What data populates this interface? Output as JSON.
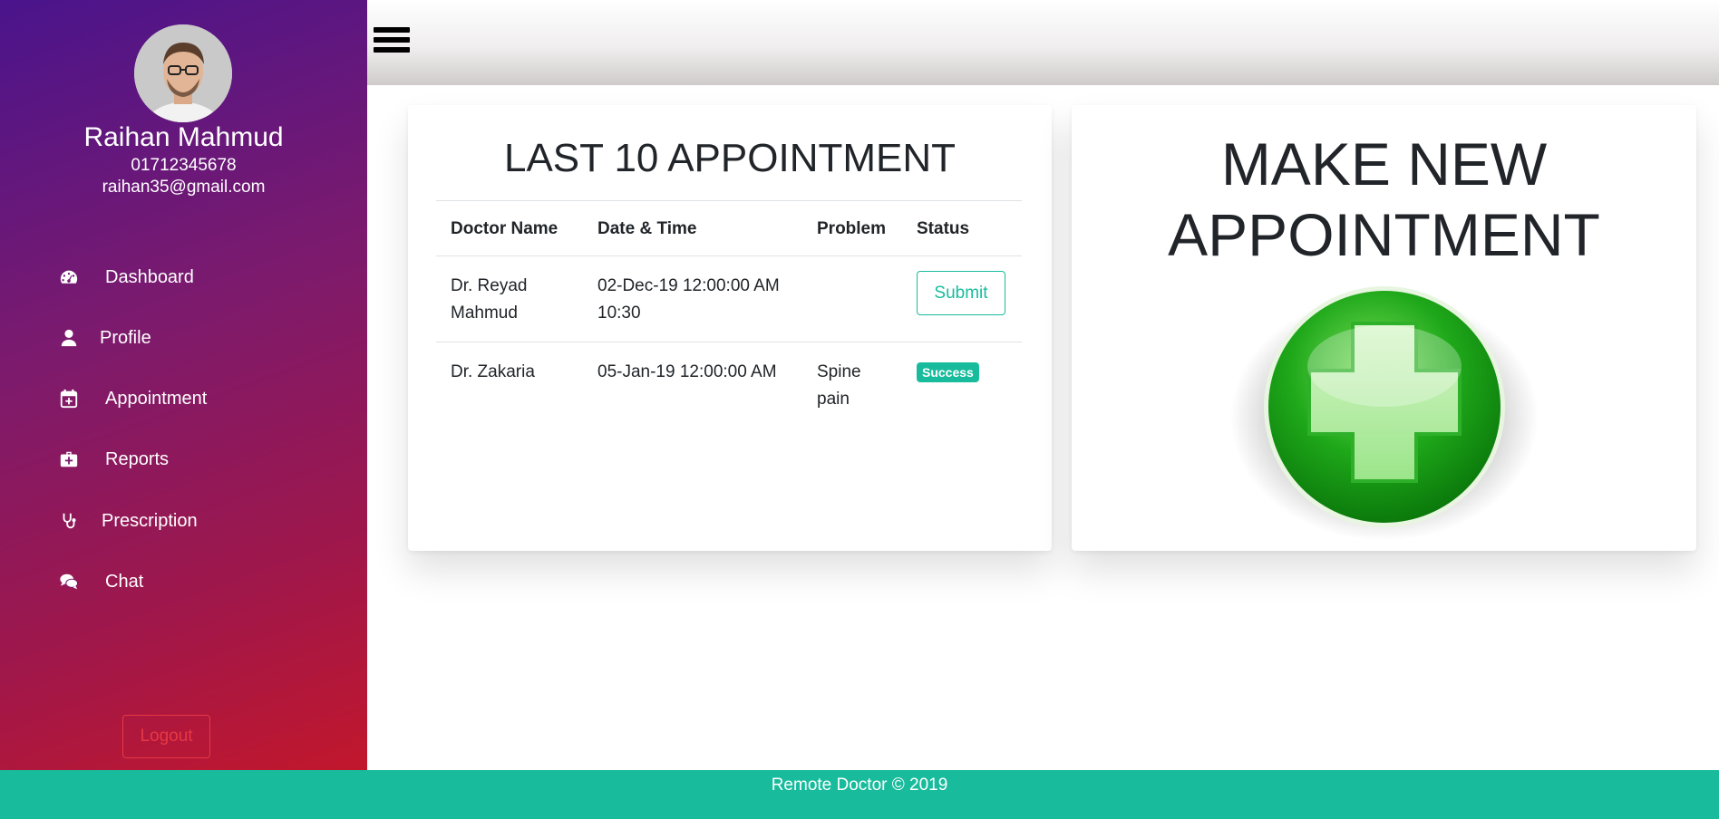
{
  "profile": {
    "name": "Raihan Mahmud",
    "phone": "01712345678",
    "email": "raihan35@gmail.com"
  },
  "sidebar": {
    "items": [
      {
        "label": "Dashboard",
        "icon": "dashboard-icon"
      },
      {
        "label": "Profile",
        "icon": "user-icon"
      },
      {
        "label": "Appointment",
        "icon": "calendar-plus-icon"
      },
      {
        "label": "Reports",
        "icon": "medkit-icon"
      },
      {
        "label": "Prescription",
        "icon": "stethoscope-icon"
      },
      {
        "label": "Chat",
        "icon": "comments-icon"
      }
    ],
    "logout_label": "Logout"
  },
  "appointments": {
    "title": "LAST 10 APPOINTMENT",
    "columns": [
      "Doctor Name",
      "Date & Time",
      "Problem",
      "Status"
    ],
    "rows": [
      {
        "doctor": "Dr. Reyad Mahmud",
        "datetime": "02-Dec-19 12:00:00 AM 10:30",
        "problem": "",
        "status": "Submit"
      },
      {
        "doctor": "Dr. Zakaria",
        "datetime": "05-Jan-19 12:00:00 AM",
        "problem": "Spine pain",
        "status": "Success"
      }
    ]
  },
  "new_appointment": {
    "title_line1": "MAKE NEW",
    "title_line2": "APPOINTMENT"
  },
  "footer": {
    "text": "Remote Doctor © 2019"
  },
  "colors": {
    "accent": "#18bc9c",
    "danger": "#e53945",
    "sidebar_top": "#4a148c",
    "sidebar_bottom": "#c2172c"
  }
}
